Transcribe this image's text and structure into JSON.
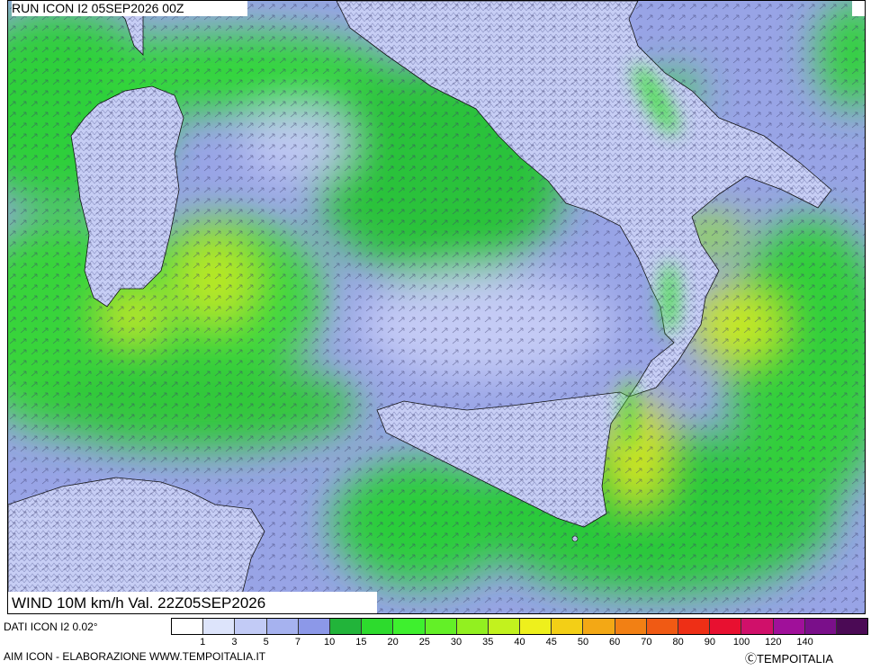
{
  "header": {
    "run_label": "RUN ICON I2 05SEP2026 00Z"
  },
  "footer": {
    "valid_label": "WIND 10M km/h Val. 22Z05SEP2026",
    "data_source": "DATI ICON I2 0.02°",
    "credit": "AIM ICON - ELABORAZIONE WWW.TEMPOITALIA.IT",
    "brand": "ⒸTEMPOITALIA"
  },
  "legend": {
    "unit": "km/h",
    "colors": [
      "#ffffff",
      "#dde4fb",
      "#c2cbf6",
      "#a6b2ef",
      "#8c98e8",
      "#22b43a",
      "#2ddb2d",
      "#3ef02e",
      "#63f027",
      "#92f020",
      "#c2f21e",
      "#eef01c",
      "#f3cf16",
      "#f3a815",
      "#f28014",
      "#f05a14",
      "#ee2f16",
      "#e81030",
      "#d0106a",
      "#a0109a",
      "#7a0f8a",
      "#4b0a55"
    ],
    "ticks": [
      "1",
      "3",
      "5",
      "7",
      "10",
      "15",
      "20",
      "25",
      "30",
      "35",
      "40",
      "45",
      "50",
      "60",
      "70",
      "80",
      "90",
      "100",
      "120",
      "140"
    ]
  },
  "map": {
    "region": "Southern Italy",
    "labeled_features": [
      "Sardinia",
      "Sicily",
      "Calabria",
      "Tunisia"
    ]
  }
}
